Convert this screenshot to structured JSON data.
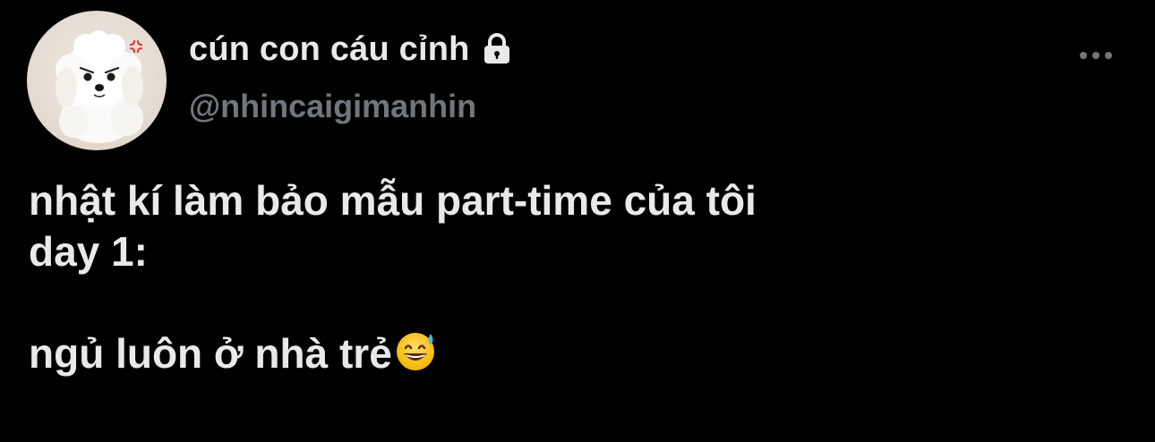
{
  "user": {
    "display_name": "cún con cáu cỉnh",
    "handle": "@nhincaigimanhin",
    "protected": true,
    "avatar_icon": "avatar-puppy"
  },
  "tweet": {
    "lines": [
      "nhật kí làm bảo mẫu part-time của tôi",
      "day 1:",
      "",
      "ngủ luôn ở nhà trẻ"
    ],
    "trailing_emoji": "grinning-face-with-sweat-icon"
  },
  "actions": {
    "more_icon": "more-dots-icon"
  },
  "colors": {
    "background": "#000000",
    "primary_text": "#e7e9ea",
    "secondary_text": "#71767b"
  }
}
